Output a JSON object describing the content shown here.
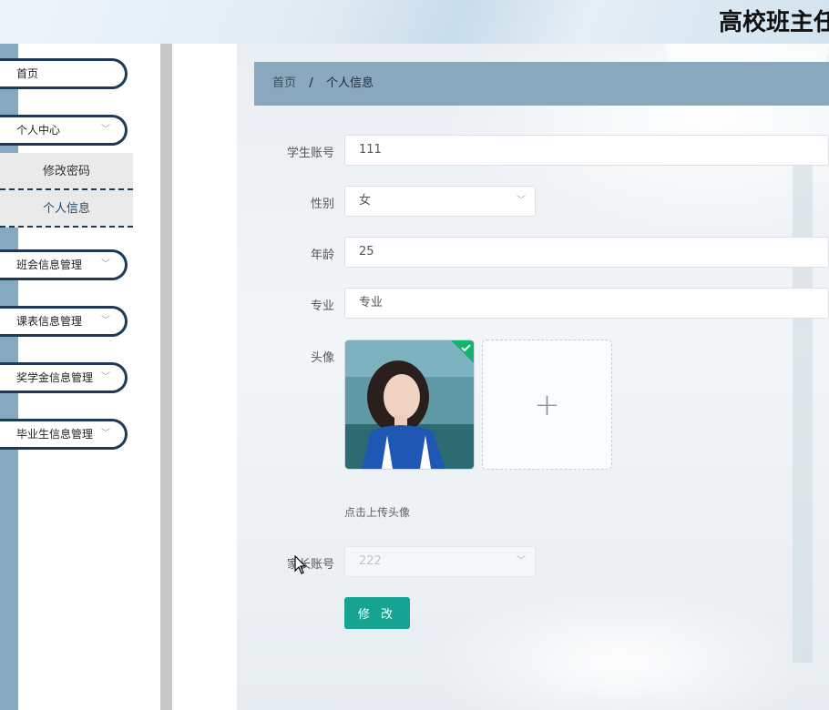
{
  "header": {
    "title": "高校班主任"
  },
  "sidebar": {
    "items": [
      {
        "label": "首页"
      },
      {
        "label": "个人中心",
        "expanded": true,
        "children": [
          {
            "label": "修改密码"
          },
          {
            "label": "个人信息",
            "active": true
          }
        ]
      },
      {
        "label": "班会信息管理"
      },
      {
        "label": "课表信息管理"
      },
      {
        "label": "奖学金信息管理"
      },
      {
        "label": "毕业生信息管理"
      }
    ]
  },
  "breadcrumb": {
    "home": "首页",
    "separator": "/",
    "current": "个人信息"
  },
  "form": {
    "student_account": {
      "label": "学生账号",
      "value": "111"
    },
    "gender": {
      "label": "性别",
      "value": "女"
    },
    "age": {
      "label": "年龄",
      "value": "25"
    },
    "major": {
      "label": "专业",
      "value": "专业"
    },
    "avatar": {
      "label": "头像",
      "upload_icon": "+",
      "hint": "点击上传头像"
    },
    "parent_account": {
      "label": "家长账号",
      "value": "222"
    },
    "submit_label": "修 改"
  },
  "colors": {
    "accent": "#17a391",
    "nav_border": "#1c3a58",
    "breadcrumb_bg": "#89a7bd"
  }
}
